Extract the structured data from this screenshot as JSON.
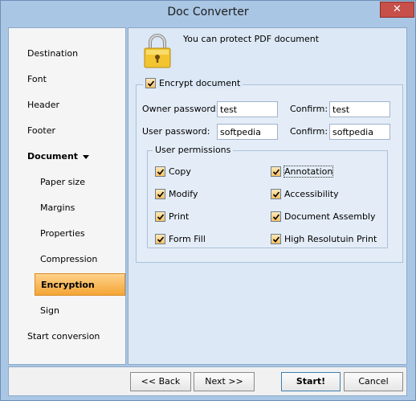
{
  "window": {
    "title": "Doc Converter",
    "close_glyph": "✕"
  },
  "sidebar": {
    "items": [
      {
        "label": "Destination"
      },
      {
        "label": "Font"
      },
      {
        "label": "Header"
      },
      {
        "label": "Footer"
      },
      {
        "label": "Document"
      },
      {
        "label": "Paper size"
      },
      {
        "label": "Margins"
      },
      {
        "label": "Properties"
      },
      {
        "label": "Compression"
      },
      {
        "label": "Encryption"
      },
      {
        "label": "Sign"
      },
      {
        "label": "Start conversion"
      }
    ],
    "active": "Encryption"
  },
  "content": {
    "header_text": "You can protect PDF document",
    "encrypt": {
      "label": "Encrypt document",
      "checked": true
    },
    "owner_password": {
      "label": "Owner password:",
      "value": "test"
    },
    "owner_confirm": {
      "label": "Confirm:",
      "value": "test"
    },
    "user_password": {
      "label": "User password:",
      "value": "softpedia"
    },
    "user_confirm": {
      "label": "Confirm:",
      "value": "softpedia"
    },
    "permissions": {
      "title": "User permissions",
      "items": [
        {
          "label": "Copy",
          "checked": true
        },
        {
          "label": "Annotation",
          "checked": true
        },
        {
          "label": "Modify",
          "checked": true
        },
        {
          "label": "Accessibility",
          "checked": true
        },
        {
          "label": "Print",
          "checked": true
        },
        {
          "label": "Document Assembly",
          "checked": true
        },
        {
          "label": "Form Fill",
          "checked": true
        },
        {
          "label": "High Resolutuin Print",
          "checked": true
        }
      ]
    }
  },
  "footer": {
    "back_label": "<< Back",
    "next_label": "Next >>",
    "start_label": "Start!",
    "cancel_label": "Cancel"
  },
  "colors": {
    "active_item": "#f4a535",
    "window_frame": "#a9c6e4",
    "close_button": "#c7504a"
  }
}
